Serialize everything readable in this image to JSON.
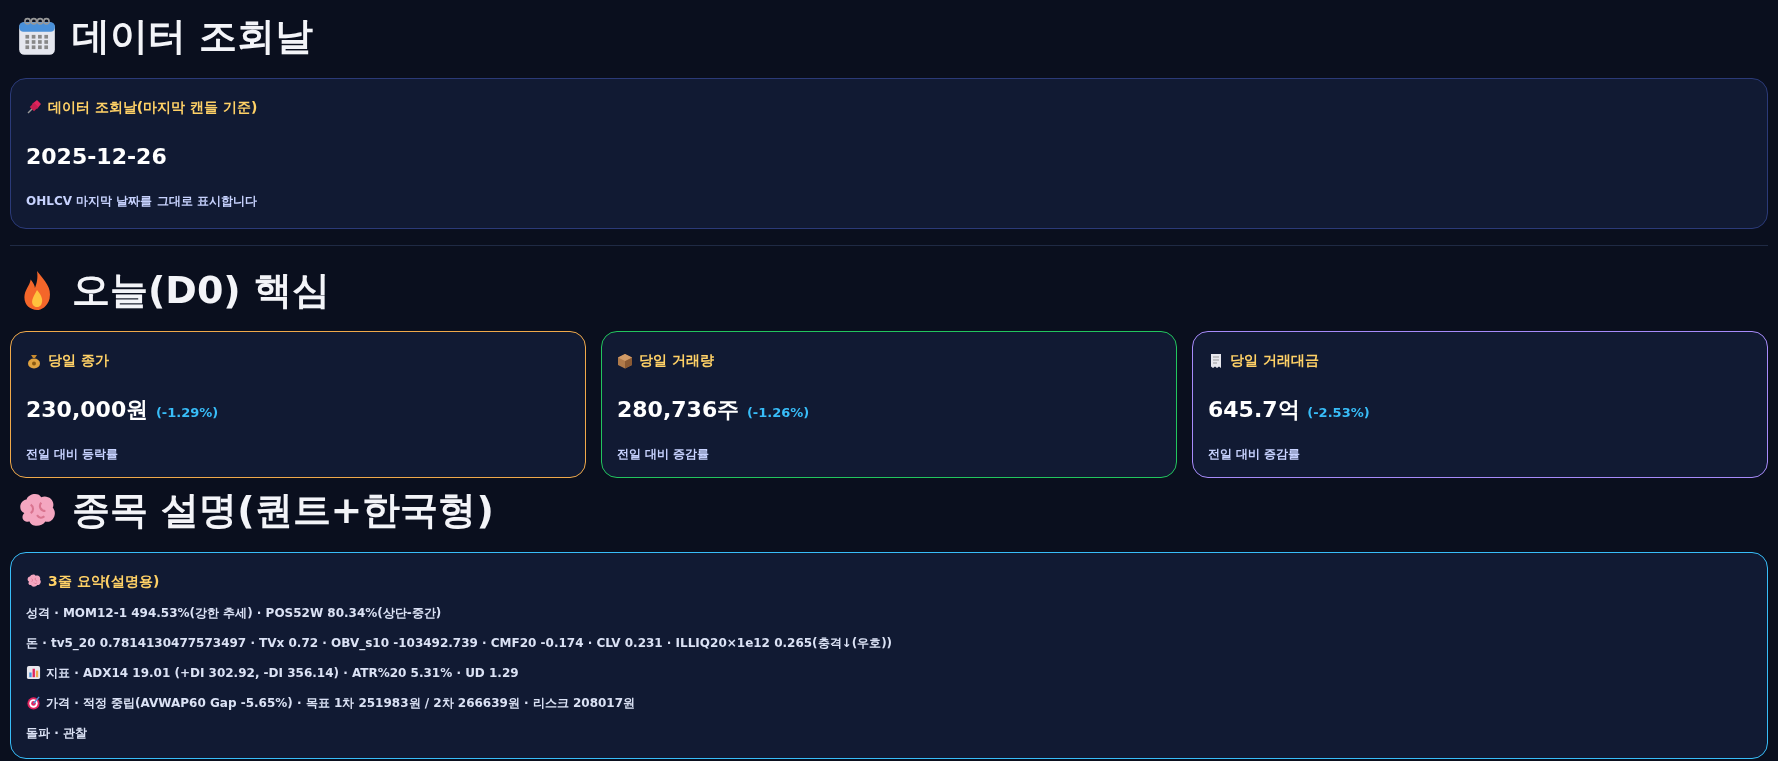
{
  "sections": [
    {
      "kind": "date",
      "heading": "데이터 조회날",
      "card": {
        "title": "데이터 조회날(마지막 캔들 기준)",
        "value": "2025-12-26",
        "note": "OHLCV 마지막 날짜를 그대로 표시합니다",
        "color": "#2b3a78"
      }
    },
    {
      "kind": "metrics",
      "heading": "오늘(D0) 핵심",
      "cards": [
        {
          "title": "당일 종가",
          "value": "230,000원",
          "change": "(-1.29%)",
          "note": "전일 대비 등락률",
          "color": "#f0a94a"
        },
        {
          "title": "당일 거래량",
          "value": "280,736주",
          "change": "(-1.26%)",
          "note": "전일 대비 증감률",
          "color": "#22c55e"
        },
        {
          "title": "당일 거래대금",
          "value": "645.7억",
          "change": "(-2.53%)",
          "note": "전일 대비 증감률",
          "color": "#a78bfa"
        }
      ]
    },
    {
      "kind": "summary",
      "heading": "종목 설명(퀀트+한국형)",
      "card": {
        "title": "3줄 요약(설명용)",
        "color": "#38bdf8",
        "lines": [
          {
            "kind": "plain",
            "text": "성격 · MOM12-1 494.53%(강한 추세) · POS52W 80.34%(상단-중간)"
          },
          {
            "kind": "plain",
            "text": "돈 · tv5_20 0.7814130477573497 · TVx 0.72 · OBV_s10 -103492.739 · CMF20 -0.174 · CLV 0.231 · ILLIQ20×1e12 0.265(충격↓(우호))"
          },
          {
            "kind": "chart",
            "text": "지표 · ADX14 19.01 (+DI 302.92, -DI 356.14) · ATR%20 5.31% · UD 1.29"
          },
          {
            "kind": "target",
            "text": "가격 · 적정 중립(AVWAP60 Gap -5.65%) · 목표 1차 251983원 / 2차 266639원 · 리스크 208017원"
          },
          {
            "kind": "plain",
            "text": "돌파 · 관찰"
          }
        ]
      }
    }
  ]
}
